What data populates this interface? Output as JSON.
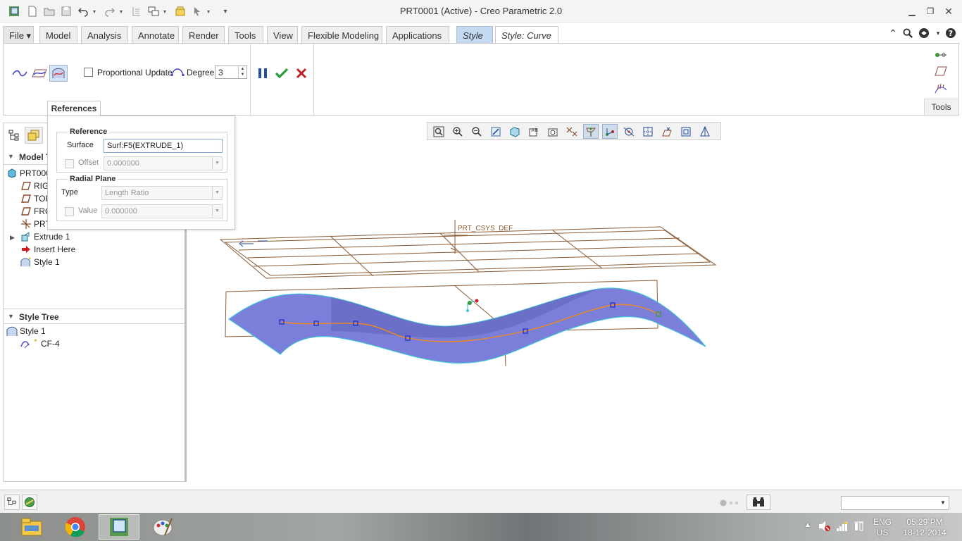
{
  "window": {
    "title": "PRT0001 (Active) - Creo Parametric 2.0"
  },
  "ribbon_tabs": [
    {
      "label": "File ▾"
    },
    {
      "label": "Model"
    },
    {
      "label": "Analysis"
    },
    {
      "label": "Annotate"
    },
    {
      "label": "Render"
    },
    {
      "label": "Tools"
    },
    {
      "label": "View"
    },
    {
      "label": "Flexible Modeling"
    },
    {
      "label": "Applications"
    },
    {
      "label": "Style"
    },
    {
      "label": "Style: Curve"
    }
  ],
  "curve_tab": {
    "proportional_update_label": "Proportional Update",
    "proportional_update_checked": false,
    "degree_label": "Degree",
    "degree_value": "3",
    "references_tab": "References",
    "tools_tab": "Tools"
  },
  "references_panel": {
    "reference_group": "Reference",
    "surface_label": "Surface",
    "surface_value": "Surf:F5(EXTRUDE_1)",
    "offset_label": "Offset",
    "offset_value": "0.000000",
    "radial_group": "Radial Plane",
    "type_label": "Type",
    "type_value": "Length Ratio",
    "value_label": "Value",
    "value_value": "0.000000"
  },
  "model_tree": {
    "header": "Model T",
    "items": [
      {
        "label": "PRT000",
        "icon": "part-icon"
      },
      {
        "label": "RIG",
        "icon": "datum-plane-icon"
      },
      {
        "label": "TOF",
        "icon": "datum-plane-icon"
      },
      {
        "label": "FRC",
        "icon": "datum-plane-icon"
      },
      {
        "label": "PRT",
        "icon": "csys-icon"
      },
      {
        "label": "Extrude 1",
        "icon": "extrude-icon"
      },
      {
        "label": "Insert Here",
        "icon": "insert-arrow-icon"
      },
      {
        "label": "Style 1",
        "icon": "style-feature-icon"
      }
    ]
  },
  "style_tree": {
    "header": "Style Tree",
    "items": [
      {
        "label": "Style 1",
        "icon": "style-feature-icon"
      },
      {
        "label": "CF-4",
        "icon": "cos-curve-icon"
      }
    ]
  },
  "graphics": {
    "csys_label": "PRT_CSYS_DEF",
    "surface_color": "#7b7fd9",
    "curve_color": "#f08a1c",
    "datum_color": "#8a5a33"
  },
  "taskbar": {
    "language": "ENG",
    "region": "US",
    "time": "05:29 PM",
    "date": "18-12-2014"
  }
}
